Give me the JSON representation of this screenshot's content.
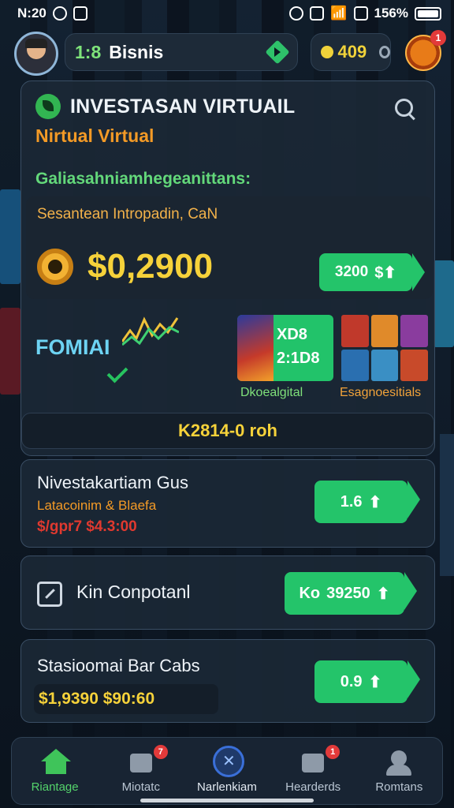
{
  "status_bar": {
    "time": "N:20",
    "battery": "156%"
  },
  "top_bar": {
    "level": "1:8",
    "username": "Bisnis",
    "coins": "409",
    "notification_count": "1"
  },
  "main_card": {
    "title": "INVESTASAN VIRTUAIL",
    "subtitle": "Nirtual Virtual",
    "section_heading": "Galiasahniamhegeanittans:",
    "balance_label": "Sesantean Intropadin, CaN",
    "balance_amount": "$0,2900",
    "balance_button": "3200",
    "fomiai_label": "FOMIAI",
    "promo_text_line1": "XD8",
    "promo_text_line2": "2:1D8",
    "promo_caption": "Dkoealgital",
    "tiles_caption": "Esagnoesitials",
    "stat_strip": "K2814-0 roh"
  },
  "list": [
    {
      "title": "Nivestakartiam Gus",
      "subtitle": "Latacoinim & Blaefa",
      "price": "$/gpr7 $4.3:00",
      "button": "1.6"
    },
    {
      "title": "Kin Conpotanl",
      "button_prefix": "Ko",
      "button": "39250"
    },
    {
      "title": "Stasioomai Bar Cabs",
      "price": "$1,9390 $90:60",
      "button": "0.9"
    }
  ],
  "nav": {
    "items": [
      {
        "label": "Riantage",
        "icon": "home-icon",
        "active": true
      },
      {
        "label": "Miotatc",
        "icon": "tasks-icon",
        "badge": "7"
      },
      {
        "label": "Narlenkiam",
        "icon": "compass-icon"
      },
      {
        "label": "Hearderds",
        "icon": "camera-icon",
        "badge": "1"
      },
      {
        "label": "Romtans",
        "icon": "person-icon"
      }
    ]
  },
  "colors": {
    "accent_green": "#24c46a",
    "gold": "#f6d23a",
    "orange": "#f39a26",
    "red": "#e0392f"
  }
}
